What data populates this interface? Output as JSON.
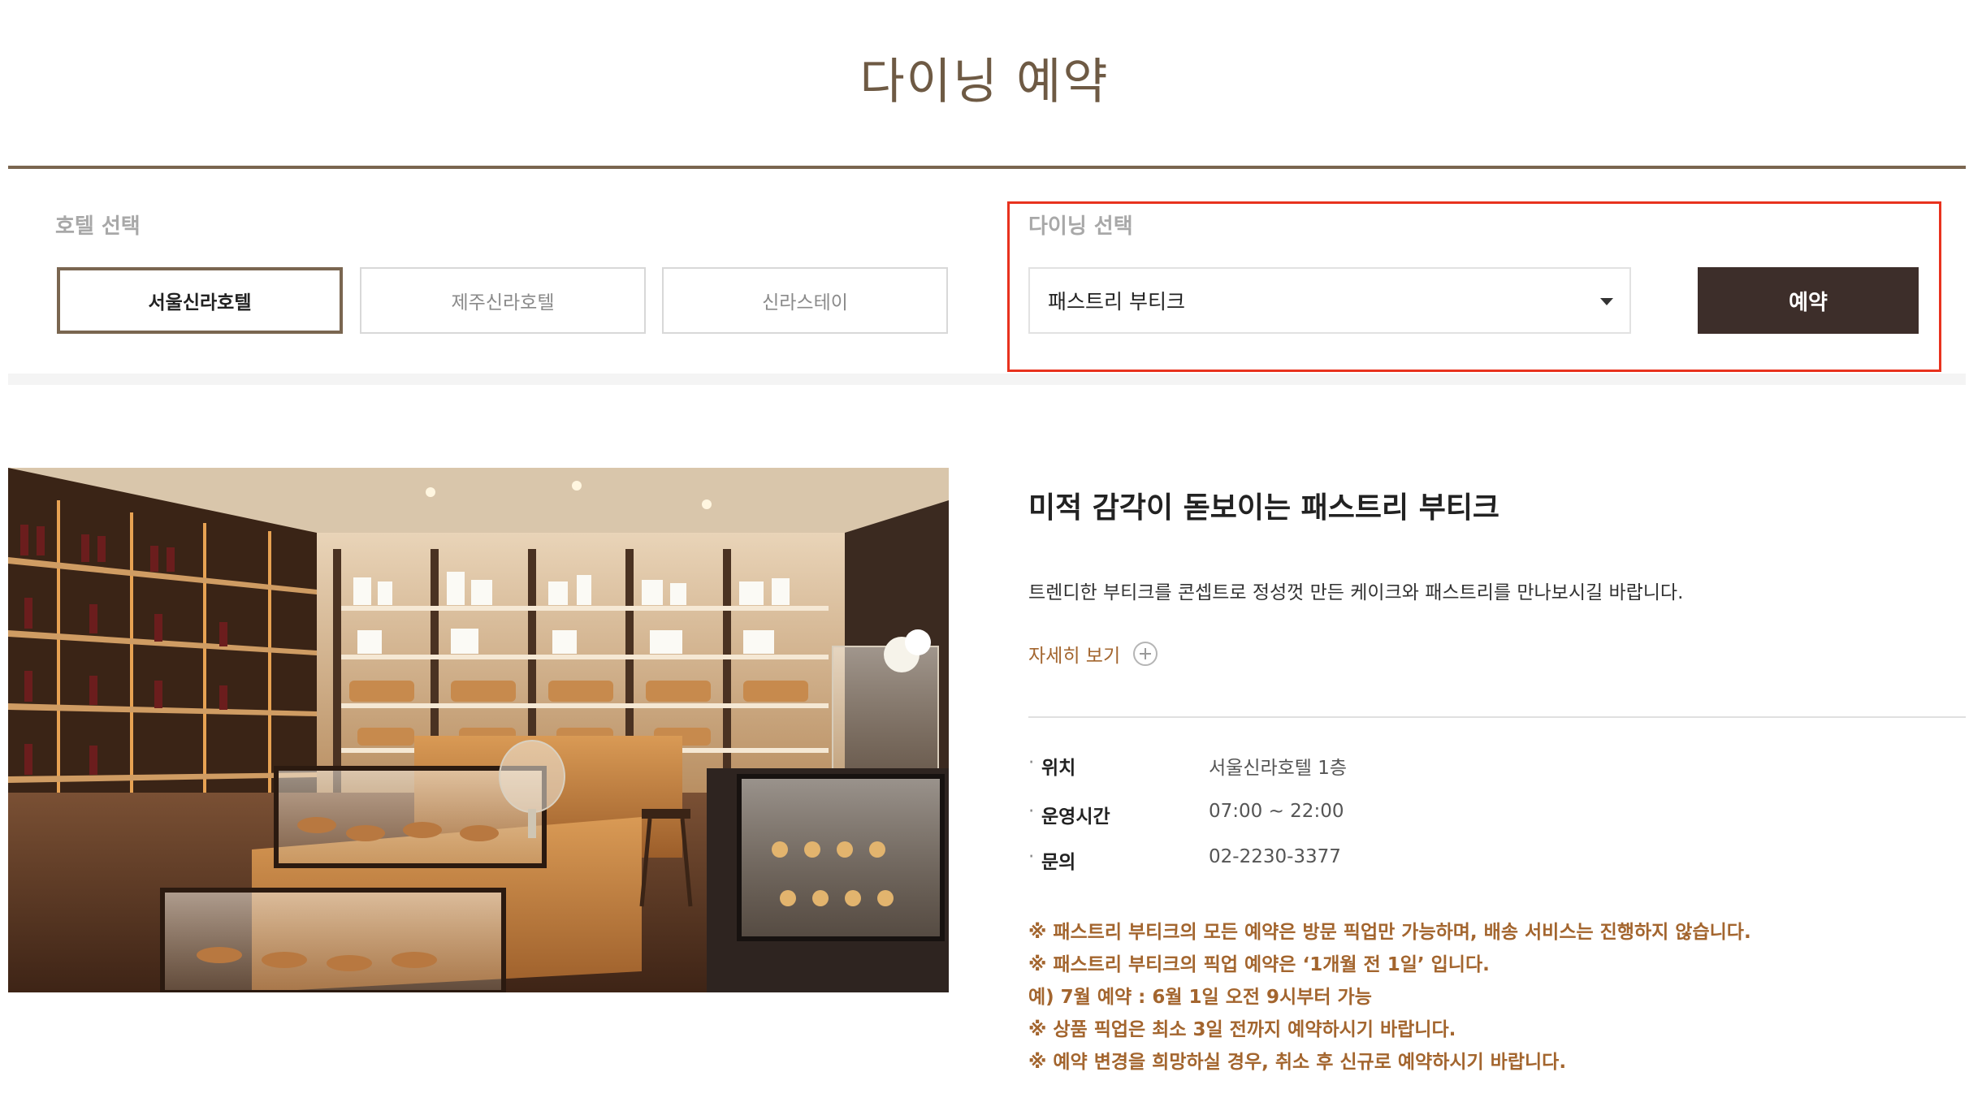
{
  "header": {
    "title": "다이닝 예약"
  },
  "hotel_select": {
    "label": "호텔 선택",
    "options": [
      {
        "label": "서울신라호텔",
        "selected": true
      },
      {
        "label": "제주신라호텔",
        "selected": false
      },
      {
        "label": "신라스테이",
        "selected": false
      }
    ]
  },
  "dining_select": {
    "label": "다이닝 선택",
    "value": "패스트리 부티크"
  },
  "reserve_button": {
    "label": "예약"
  },
  "detail": {
    "title": "미적 감각이 돋보이는 패스트리 부티크",
    "description": "트렌디한 부티크를 콘셉트로 정성껏 만든 케이크와 패스트리를 만나보시길 바랍니다.",
    "more_link": "자세히 보기",
    "info": [
      {
        "bullet": "·",
        "key": "위치",
        "value": "서울신라호텔 1층"
      },
      {
        "bullet": "·",
        "key": "운영시간",
        "value": "07:00 ~ 22:00"
      },
      {
        "bullet": "·",
        "key": "문의",
        "value": "02-2230-3377"
      }
    ],
    "notes": [
      "※ 패스트리 부티크의 모든 예약은 방문 픽업만 가능하며, 배송 서비스는 진행하지 않습니다.",
      "※ 패스트리 부티크의 픽업 예약은 ‘1개월 전 1일’ 입니다.",
      "예) 7월 예약 : 6월 1일 오전 9시부터 가능",
      "※ 상품 픽업은 최소 3일 전까지 예약하시기 바랍니다.",
      "※ 예약 변경을 희망하실 경우, 취소 후 신규로 예약하시기 바랍니다."
    ]
  },
  "colors": {
    "brand_brown": "#7a6650",
    "button_dark": "#3d2e2a",
    "link_accent": "#a3652e",
    "highlight_red": "#e8321e"
  }
}
